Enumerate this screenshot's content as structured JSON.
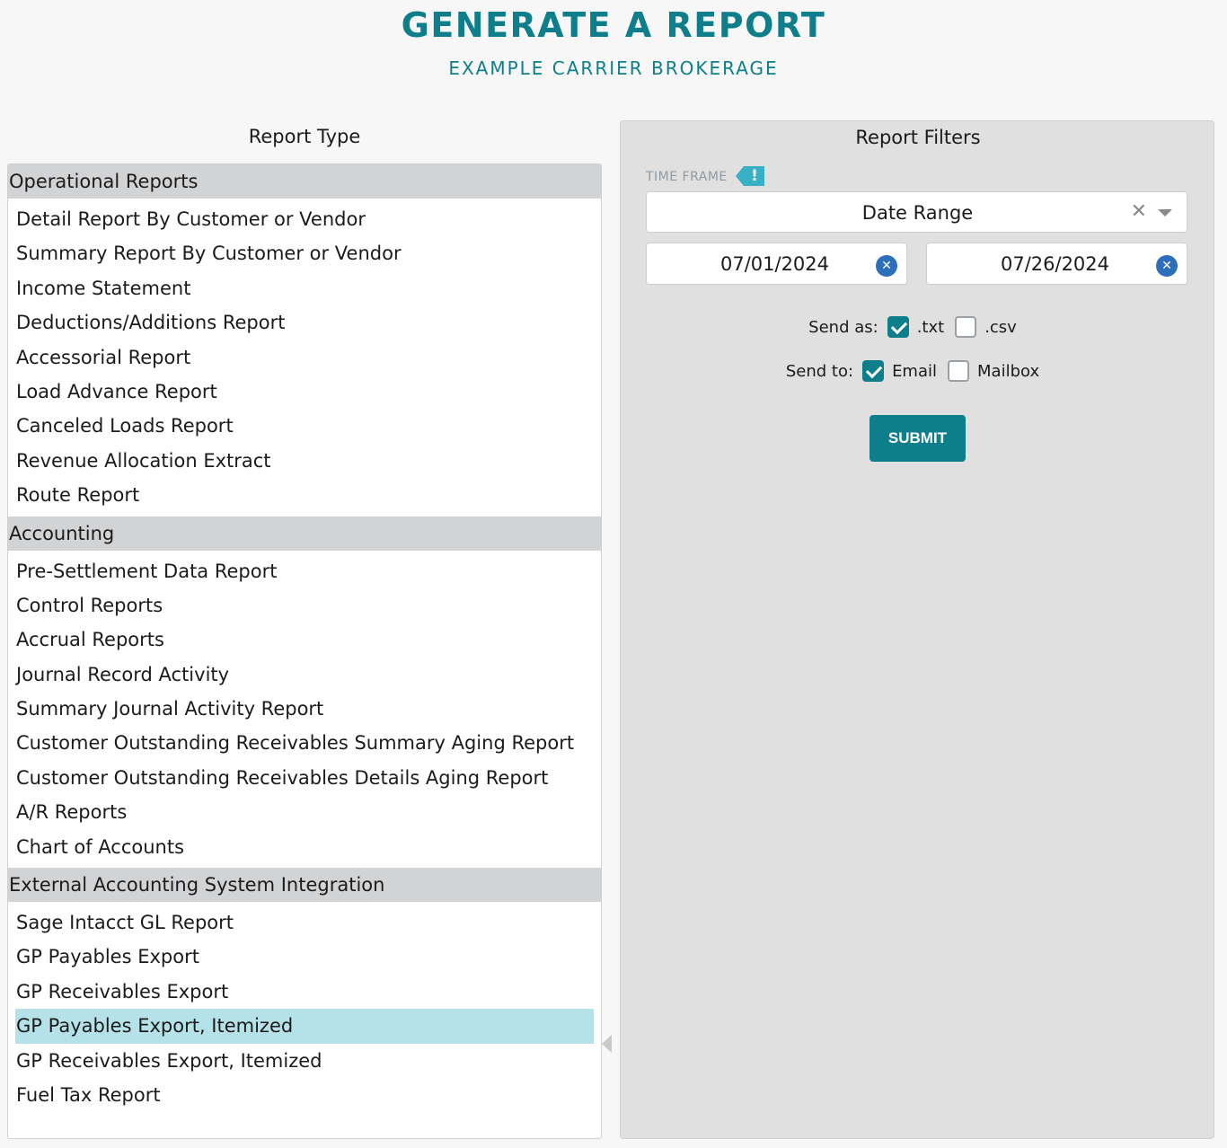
{
  "header": {
    "title": "GENERATE A REPORT",
    "subtitle": "EXAMPLE CARRIER BROKERAGE"
  },
  "report_type": {
    "title": "Report Type",
    "groups": [
      {
        "name": "Operational Reports",
        "items": [
          "Detail Report By Customer or Vendor",
          "Summary Report By Customer or Vendor",
          "Income Statement",
          "Deductions/Additions Report",
          "Accessorial Report",
          "Load Advance Report",
          "Canceled Loads Report",
          "Revenue Allocation Extract",
          "Route Report"
        ]
      },
      {
        "name": "Accounting",
        "items": [
          "Pre-Settlement Data Report",
          "Control Reports",
          "Accrual Reports",
          "Journal Record Activity",
          "Summary Journal Activity Report",
          "Customer Outstanding Receivables Summary Aging Report",
          "Customer Outstanding Receivables Details Aging Report",
          "A/R Reports",
          "Chart of Accounts"
        ]
      },
      {
        "name": "External Accounting System Integration",
        "items": [
          "Sage Intacct GL Report",
          "GP Payables Export",
          "GP Receivables Export",
          "GP Payables Export, Itemized",
          "GP Receivables Export, Itemized",
          "Fuel Tax Report"
        ]
      }
    ],
    "selected": "GP Payables Export, Itemized"
  },
  "filters": {
    "title": "Report Filters",
    "time_frame_label": "TIME FRAME",
    "time_frame_badge": "!",
    "time_frame_value": "Date Range",
    "clear_symbol": "✕",
    "start_date": "07/01/2024",
    "end_date": "07/26/2024",
    "date_clear_symbol": "✕",
    "send_as_label": "Send as:",
    "send_as_options": [
      {
        "label": ".txt",
        "checked": true
      },
      {
        "label": ".csv",
        "checked": false
      }
    ],
    "send_to_label": "Send to:",
    "send_to_options": [
      {
        "label": "Email",
        "checked": true
      },
      {
        "label": "Mailbox",
        "checked": false
      }
    ],
    "submit_label": "SUBMIT"
  },
  "colors": {
    "accent": "#0e7f8a",
    "selected_row": "#b5e2e8",
    "group_header": "#d2d3d5",
    "badge": "#3ab0c6",
    "date_clear": "#2d6fba"
  }
}
